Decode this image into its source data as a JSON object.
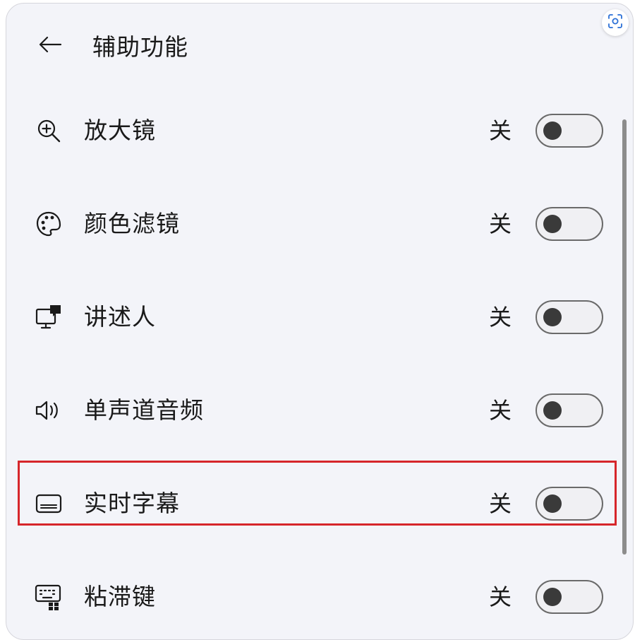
{
  "header": {
    "back_icon": "arrow-left-icon",
    "title": "辅助功能",
    "scan_icon": "screen-scan-icon"
  },
  "settings": [
    {
      "icon": "magnifier-plus-icon",
      "label": "放大镜",
      "state": "关",
      "on": false
    },
    {
      "icon": "palette-icon",
      "label": "颜色滤镜",
      "state": "关",
      "on": false
    },
    {
      "icon": "narrator-monitor-icon",
      "label": "讲述人",
      "state": "关",
      "on": false
    },
    {
      "icon": "speaker-icon",
      "label": "单声道音频",
      "state": "关",
      "on": false
    },
    {
      "icon": "captions-icon",
      "label": "实时字幕",
      "state": "关",
      "on": false,
      "highlighted": true
    },
    {
      "icon": "keyboard-icon",
      "label": "粘滞键",
      "state": "关",
      "on": false
    }
  ],
  "colors": {
    "panel_bg": "#f3f4f9",
    "text": "#1a1a1a",
    "highlight_border": "#d6262b",
    "toggle_knob": "#3a3a3a"
  }
}
